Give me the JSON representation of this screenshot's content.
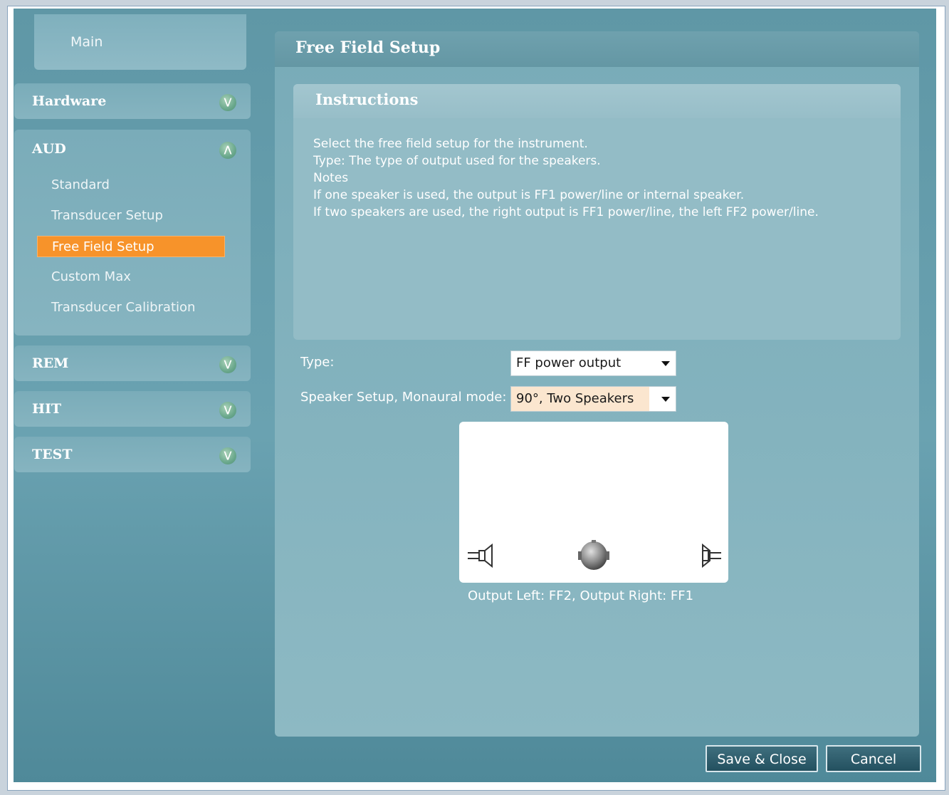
{
  "sidebar": {
    "main_label": "Main",
    "sections": [
      {
        "label": "Hardware",
        "expanded": false
      },
      {
        "label": "AUD",
        "expanded": true
      },
      {
        "label": "REM",
        "expanded": false
      },
      {
        "label": "HIT",
        "expanded": false
      },
      {
        "label": "TEST",
        "expanded": false
      }
    ],
    "aud_items": [
      "Standard",
      "Transducer Setup",
      "Free Field Setup",
      "Custom Max",
      "Transducer Calibration"
    ],
    "active_item": "Free Field Setup"
  },
  "panel": {
    "title": "Free Field Setup",
    "instructions": {
      "title": "Instructions",
      "lines": [
        "Select the free field setup for the instrument.",
        "Type: The type of output used for the speakers.",
        "Notes",
        "If one speaker is used, the output is FF1 power/line or internal speaker.",
        "If two speakers are used, the right output is FF1 power/line, the left FF2 power/line."
      ]
    },
    "type_label": "Type:",
    "type_value": "FF power output",
    "speaker_label": "Speaker Setup, Monaural mode:",
    "speaker_value": "90°, Two Speakers",
    "output_text": "Output Left: FF2, Output Right: FF1"
  },
  "buttons": {
    "save_close": "Save & Close",
    "cancel": "Cancel"
  },
  "colors": {
    "accent_active": "#f7932a",
    "panel_bg": "#6aa2b1"
  }
}
